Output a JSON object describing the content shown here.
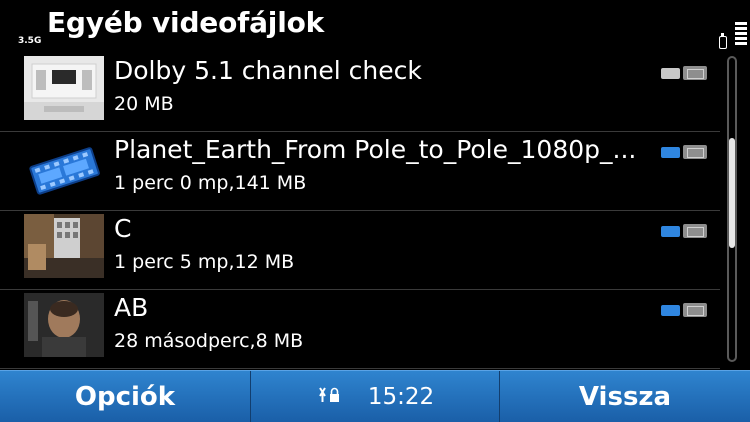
{
  "header": {
    "title": "Egyéb videofájlok",
    "network_badge": "3.5G"
  },
  "items": [
    {
      "title": "Dolby 5.1 channel check",
      "meta": "20 MB",
      "thumbnail": "dolby-thumbnail",
      "memory_color": "#c8c8c8"
    },
    {
      "title": "Planet_Earth_From Pole_to_Pole_1080p_...",
      "meta": "1 perc 0 mp,141 MB",
      "thumbnail": "video-file-icon",
      "memory_color": "#2f86e0"
    },
    {
      "title": "C",
      "meta": "1 perc 5 mp,12 MB",
      "thumbnail": "street-scene-thumbnail",
      "memory_color": "#2f86e0"
    },
    {
      "title": "AB",
      "meta": "28 másodperc,8 MB",
      "thumbnail": "portrait-thumbnail",
      "memory_color": "#2f86e0"
    }
  ],
  "scroll": {
    "position": 0.42
  },
  "softkeys": {
    "left": "Opciók",
    "clock": "15:22",
    "right": "Vissza",
    "status_icon": "antenna-lock-icon"
  },
  "colors": {
    "softkey_bar": "#2577c4",
    "background": "#000000"
  }
}
